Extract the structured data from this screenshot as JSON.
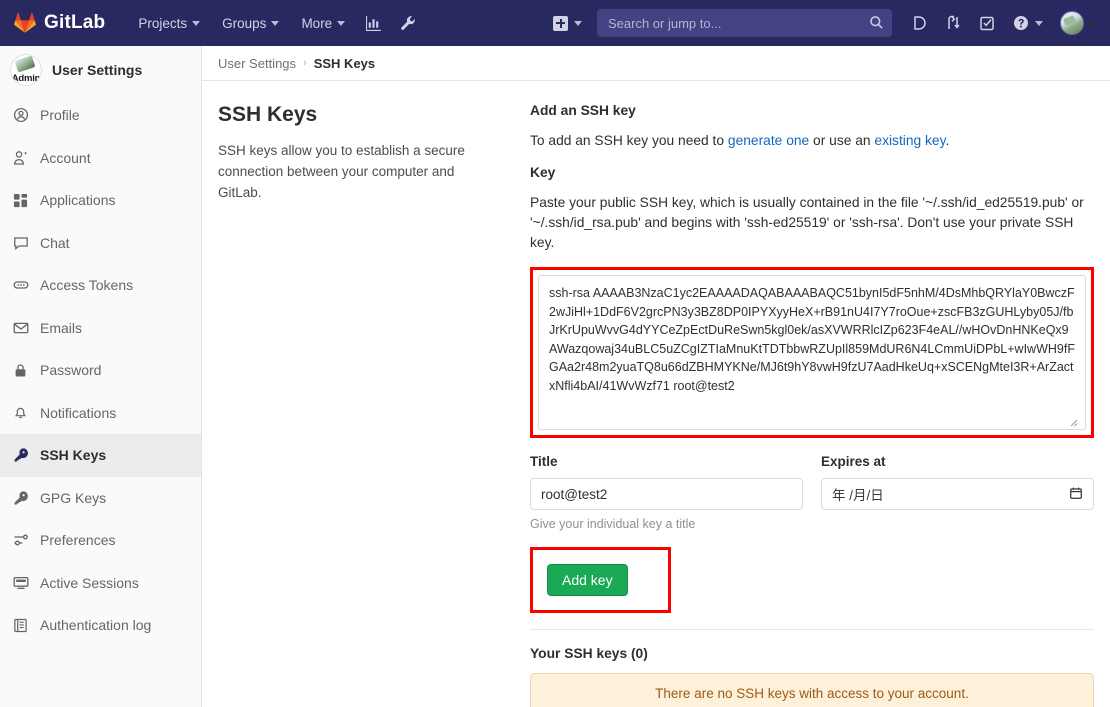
{
  "navbar": {
    "brand": "GitLab",
    "links": [
      {
        "label": "Projects",
        "caret": true
      },
      {
        "label": "Groups",
        "caret": true
      },
      {
        "label": "More",
        "caret": true
      }
    ],
    "icons": [
      {
        "name": "analytics-icon"
      },
      {
        "name": "wrench-icon"
      }
    ],
    "create_new": {
      "name": "plus-icon",
      "caret": true
    },
    "search": {
      "placeholder": "Search or jump to...",
      "value": ""
    },
    "right_icons": [
      {
        "name": "issues-icon"
      },
      {
        "name": "merge-requests-icon"
      },
      {
        "name": "todos-icon"
      },
      {
        "name": "help-icon",
        "caret": true
      }
    ],
    "avatar": {
      "name": "user-avatar",
      "caret": true
    }
  },
  "sidebar": {
    "title": "User Settings",
    "avatar_caption": "Admin",
    "items": [
      {
        "label": "Profile",
        "icon": "user-circle-icon",
        "active": false
      },
      {
        "label": "Account",
        "icon": "user-gear-icon",
        "active": false
      },
      {
        "label": "Applications",
        "icon": "apps-grid-icon",
        "active": false
      },
      {
        "label": "Chat",
        "icon": "chat-bubble-icon",
        "active": false
      },
      {
        "label": "Access Tokens",
        "icon": "token-icon",
        "active": false
      },
      {
        "label": "Emails",
        "icon": "envelope-icon",
        "active": false
      },
      {
        "label": "Password",
        "icon": "lock-icon",
        "active": false
      },
      {
        "label": "Notifications",
        "icon": "bell-icon",
        "active": false
      },
      {
        "label": "SSH Keys",
        "icon": "key-icon",
        "active": true
      },
      {
        "label": "GPG Keys",
        "icon": "key-icon",
        "active": false
      },
      {
        "label": "Preferences",
        "icon": "sliders-icon",
        "active": false
      },
      {
        "label": "Active Sessions",
        "icon": "monitor-icon",
        "active": false
      },
      {
        "label": "Authentication log",
        "icon": "log-book-icon",
        "active": false
      }
    ]
  },
  "breadcrumb": {
    "parent": "User Settings",
    "separator": "›",
    "current": "SSH Keys"
  },
  "panel": {
    "title": "SSH Keys",
    "description": "SSH keys allow you to establish a secure connection between your computer and GitLab."
  },
  "form": {
    "heading": "Add an SSH key",
    "intro_prefix": "To add an SSH key you need to ",
    "intro_link1": "generate one",
    "intro_middle": " or use an ",
    "intro_link2": "existing key",
    "intro_suffix": ".",
    "key_label": "Key",
    "key_help": "Paste your public SSH key, which is usually contained in the file '~/.ssh/id_ed25519.pub' or '~/.ssh/id_rsa.pub' and begins with 'ssh-ed25519' or 'ssh-rsa'. Don't use your private SSH key.",
    "key_value": "ssh-rsa AAAAB3NzaC1yc2EAAAADAQABAAABAQC51bynI5dF5nhM/4DsMhbQRYlaY0BwczF2wJiHl+1DdF6V2grcPN3y3BZ8DP0IPYXyyHeX+rB91nU4I7Y7roOue+zscFB3zGUHLyby05J/fbJrKrUpuWvvG4dYYCeZpEctDuReSwn5kgl0ek/asXVWRRlcIZp623F4eAL//wHOvDnHNKeQx9AWazqowaj34uBLC5uZCgIZTIaMnuKtTDTbbwRZUpIl859MdUR6N4LCmmUiDPbL+wIwWH9fFGAa2r48m2yuaTQ8u66dZBHMYKNe/MJ6t9hY8vwH9fzU7AadHkeUq+xSCENgMteI3R+ArZactxNfli4bAI/41WvWzf71 root@test2",
    "title_label": "Title",
    "title_value": "root@test2",
    "title_help": "Give your individual key a title",
    "expires_label": "Expires at",
    "expires_placeholder": "年 /月/日",
    "submit_label": "Add key"
  },
  "keys_list": {
    "heading": "Your SSH keys (0)",
    "empty_message": "There are no SSH keys with access to your account."
  },
  "colors": {
    "navbar_bg": "#292961",
    "accent_green": "#1aaa55",
    "link_blue": "#1068bf",
    "highlight_red": "#fd0000",
    "warning_bg": "#fdf1dc",
    "warning_text": "#a05a13"
  }
}
